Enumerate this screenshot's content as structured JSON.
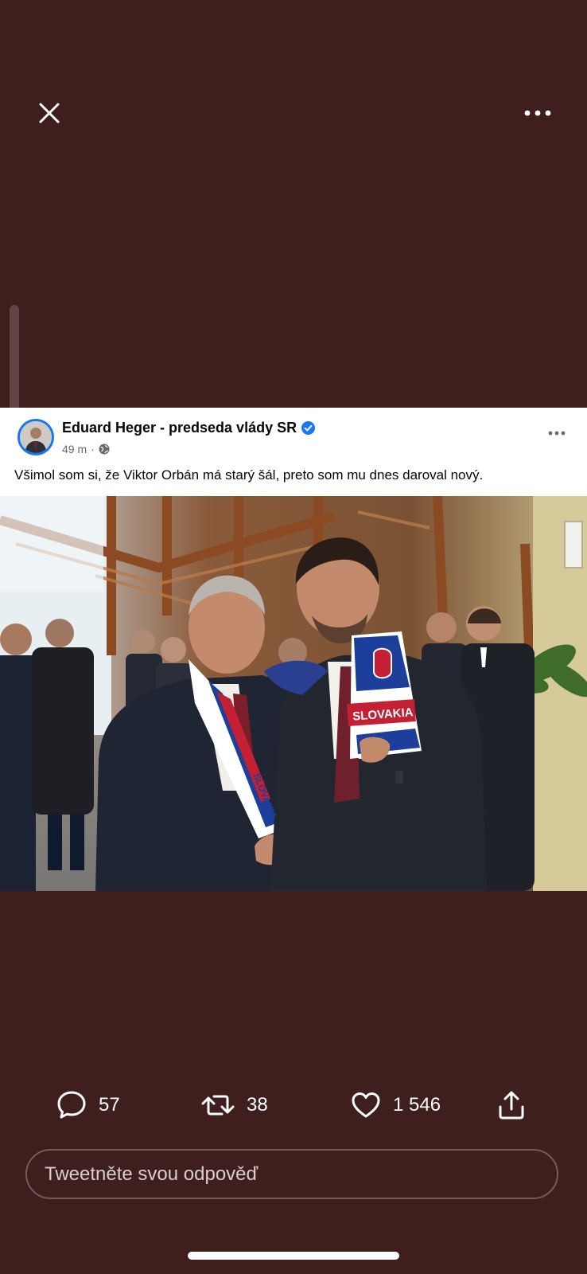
{
  "app": {
    "background_color": "#3f1e1e"
  },
  "topbar": {
    "close_icon": "close-icon",
    "more_icon": "more-horizontal-icon"
  },
  "post": {
    "author": "Eduard Heger - predseda vlády SR",
    "verified": true,
    "time": "49 m",
    "visibility_icon": "globe-icon",
    "caption": "Všimol som si, že Viktor Orbán má starý šál, preto som mu dnes daroval nový.",
    "photo": {
      "scarf_text_1": "SLOVAKIA",
      "scarf_text_2": "SLOVAKIA"
    }
  },
  "actions": {
    "reply_count": "57",
    "retweet_count": "38",
    "like_count": "1 546"
  },
  "reply": {
    "placeholder": "Tweetněte svou odpověď"
  },
  "colors": {
    "verified_blue": "#1877f2"
  }
}
